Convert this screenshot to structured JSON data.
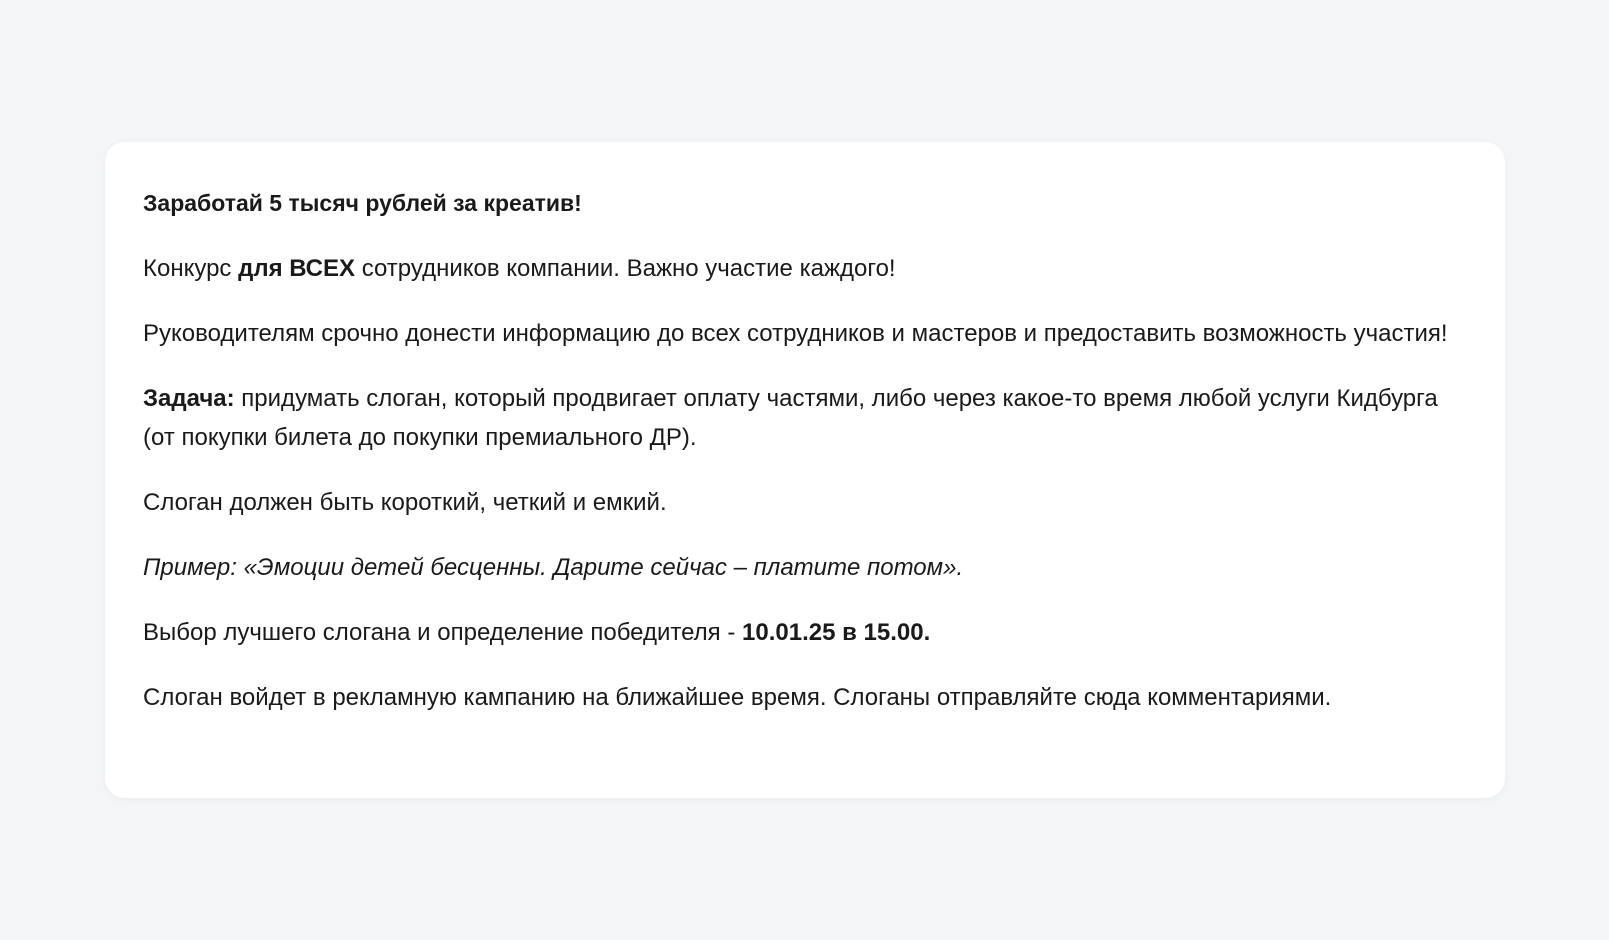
{
  "post": {
    "title": "Заработай 5 тысяч рублей за креатив!",
    "p1": {
      "before": "Конкурс ",
      "bold": "для ВСЕХ",
      "after": " сотрудников компании. Важно участие каждого!"
    },
    "p2": "Руководителям срочно донести информацию до всех сотрудников и мастеров и предоставить возможность участия!",
    "p3": {
      "bold": "Задача:",
      "text": " придумать слоган, который продвигает оплату частями, либо через какое-то время любой услуги Кидбурга (от покупки билета до покупки премиального ДР)."
    },
    "p4": "Слоган должен быть короткий, четкий и емкий.",
    "p5": "Пример: «Эмоции детей бесценны. Дарите сейчас – платите потом».",
    "p6": {
      "text": "Выбор лучшего слогана и определение победителя -  ",
      "bold": "10.01.25 в 15.00."
    },
    "p7": "Слоган войдет в рекламную кампанию на ближайшее время. Слоганы отправляйте сюда комментариями."
  }
}
